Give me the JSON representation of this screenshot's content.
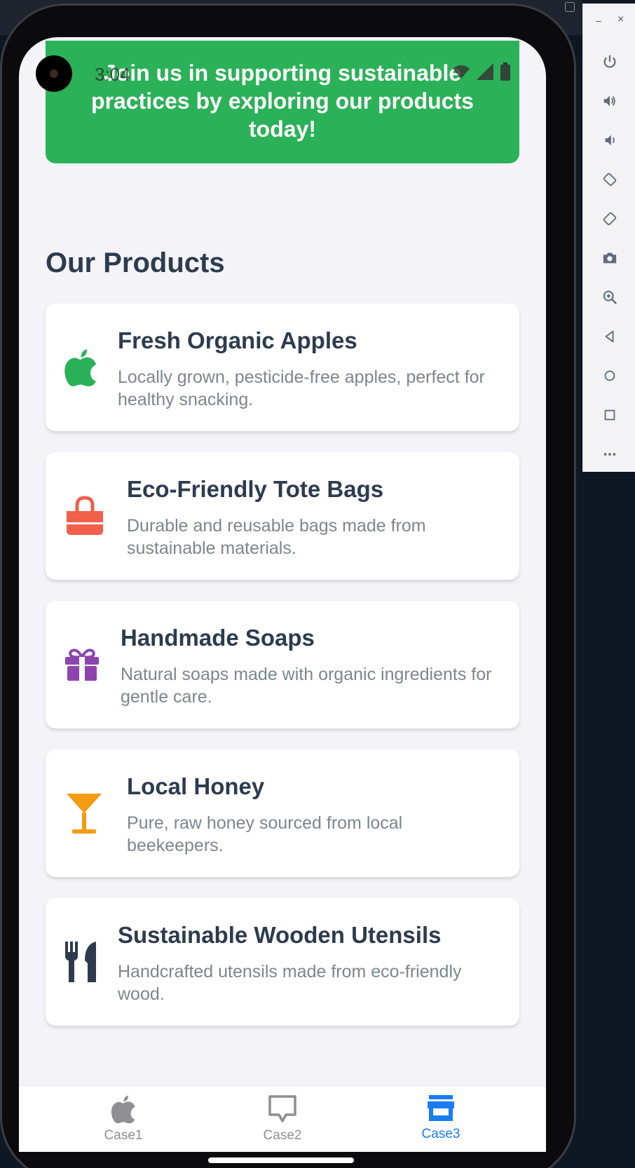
{
  "status_bar": {
    "time": "3:04"
  },
  "banner": {
    "text": "Join us in supporting sustainable practices by exploring our products today!"
  },
  "products_section": {
    "title": "Our Products",
    "items": [
      {
        "name": "Fresh Organic Apples",
        "description": "Locally grown, pesticide-free apples, perfect for healthy snacking.",
        "icon": "apple-icon",
        "color": "#2bb158"
      },
      {
        "name": "Eco-Friendly Tote Bags",
        "description": "Durable and reusable bags made from sustainable materials.",
        "icon": "shopping-bag-icon",
        "color": "#f0604a"
      },
      {
        "name": "Handmade Soaps",
        "description": "Natural soaps made with organic ingredients for gentle care.",
        "icon": "gift-icon",
        "color": "#8e44ad"
      },
      {
        "name": "Local Honey",
        "description": "Pure, raw honey sourced from local beekeepers.",
        "icon": "cocktail-glass-icon",
        "color": "#f39c12"
      },
      {
        "name": "Sustainable Wooden Utensils",
        "description": "Handcrafted utensils made from eco-friendly wood.",
        "icon": "utensils-icon",
        "color": "#2d3b4e"
      }
    ]
  },
  "tab_bar": {
    "tabs": [
      {
        "label": "Case1",
        "icon": "apple-icon"
      },
      {
        "label": "Case2",
        "icon": "chat-bubble-icon"
      },
      {
        "label": "Case3",
        "icon": "store-icon",
        "active": true
      }
    ],
    "active_color": "#1a7cf0"
  },
  "emulator_toolbar": {
    "minimize": "–",
    "close": "×",
    "buttons": [
      "power-icon",
      "volume-up-icon",
      "volume-down-icon",
      "rotate-left-icon",
      "rotate-right-icon",
      "camera-icon",
      "zoom-icon",
      "back-icon",
      "home-icon",
      "overview-icon",
      "more-icon"
    ]
  }
}
